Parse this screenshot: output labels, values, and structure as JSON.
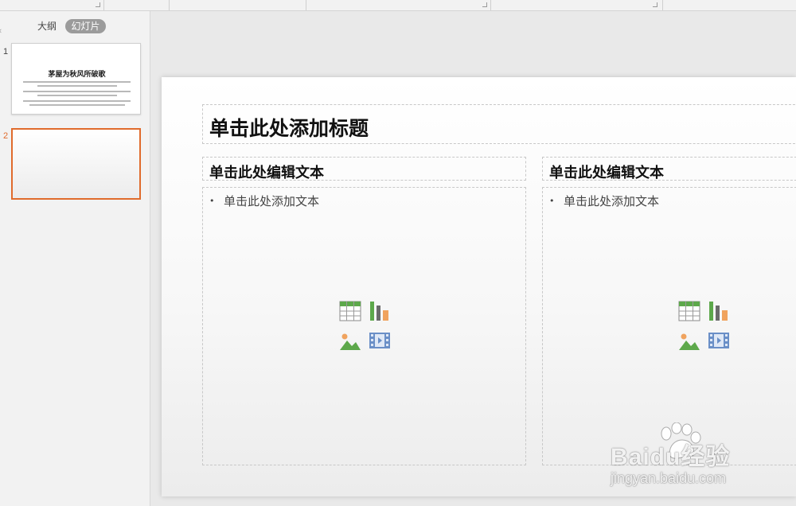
{
  "left_pane": {
    "tabs": [
      "大纲",
      "幻灯片"
    ],
    "active_tab": "幻灯片",
    "slides": [
      {
        "number": "1",
        "title": "茅屋为秋风所破歌"
      },
      {
        "number": "2",
        "selected": true
      }
    ]
  },
  "slide": {
    "title_placeholder": "单击此处添加标题",
    "left_column": {
      "heading": "单击此处编辑文本",
      "bullet": "单击此处添加文本"
    },
    "right_column": {
      "heading": "单击此处编辑文本",
      "bullet": "单击此处添加文本"
    },
    "insert_icons": [
      "table-icon",
      "chart-icon",
      "picture-icon",
      "video-icon"
    ]
  },
  "watermark": {
    "brand": "Baidu经验",
    "url": "jingyan.baidu.com"
  },
  "colors": {
    "accent": "#e06b2c",
    "background": "#e9e9e9",
    "table_green": "#5da84b",
    "chart_orange": "#f0a35e",
    "media_blue": "#6a8fc7"
  }
}
